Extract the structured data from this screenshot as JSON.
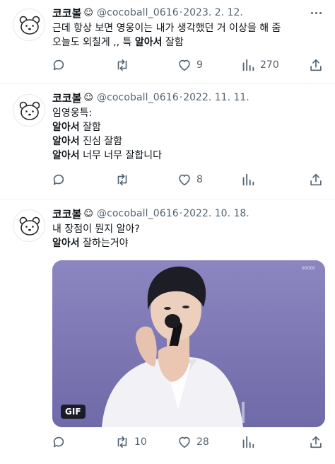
{
  "colors": {
    "text": "#0f1419",
    "secondary": "#536471",
    "divider": "#eff3f4",
    "media_background": "#7d78b4"
  },
  "tweets": [
    {
      "display_name": "코코볼",
      "name_emoji": "☺",
      "handle": "@cocoball_0616",
      "date": "2023. 2. 12.",
      "lines": [
        [
          {
            "text": "근데 항상 보면 영웅이는 내가 생각했던 거 이상을 해 줌",
            "bold": false
          }
        ],
        [
          {
            "text": "오늘도 외칠게 ,, 특 ",
            "bold": false
          },
          {
            "text": "알아서",
            "bold": true
          },
          {
            "text": " 잘함",
            "bold": false
          }
        ]
      ],
      "reply_count": "",
      "retweet_count": "",
      "like_count": "9",
      "view_count": "270"
    },
    {
      "display_name": "코코볼",
      "name_emoji": "☺",
      "handle": "@cocoball_0616",
      "date": "2022. 11. 11.",
      "lines": [
        [
          {
            "text": "임영웅특:",
            "bold": false
          }
        ],
        [
          {
            "text": "알아서",
            "bold": true
          },
          {
            "text": " 잘함",
            "bold": false
          }
        ],
        [
          {
            "text": "알아서",
            "bold": true
          },
          {
            "text": " 진심 잘함",
            "bold": false
          }
        ],
        [
          {
            "text": "알아서",
            "bold": true
          },
          {
            "text": " 너무 너무 잘합니다",
            "bold": false
          }
        ]
      ],
      "reply_count": "",
      "retweet_count": "",
      "like_count": "8",
      "view_count": ""
    },
    {
      "display_name": "코코볼",
      "name_emoji": "☺",
      "handle": "@cocoball_0616",
      "date": "2022. 10. 18.",
      "lines": [
        [
          {
            "text": "내 장점이 뭔지 알아?",
            "bold": false
          }
        ],
        [
          {
            "text": "알아서",
            "bold": true
          },
          {
            "text": " 잘하는거야",
            "bold": false
          }
        ]
      ],
      "media": {
        "badge": "GIF",
        "watermark": "00000"
      },
      "reply_count": "",
      "retweet_count": "10",
      "like_count": "28",
      "view_count": ""
    }
  ],
  "icons": {
    "more": "more-horizontal-icon",
    "reply": "reply-bubble-icon",
    "retweet": "retweet-icon",
    "like": "heart-icon",
    "views": "views-bar-chart-icon",
    "share": "share-upload-icon",
    "avatar": "bear-face-avatar"
  }
}
